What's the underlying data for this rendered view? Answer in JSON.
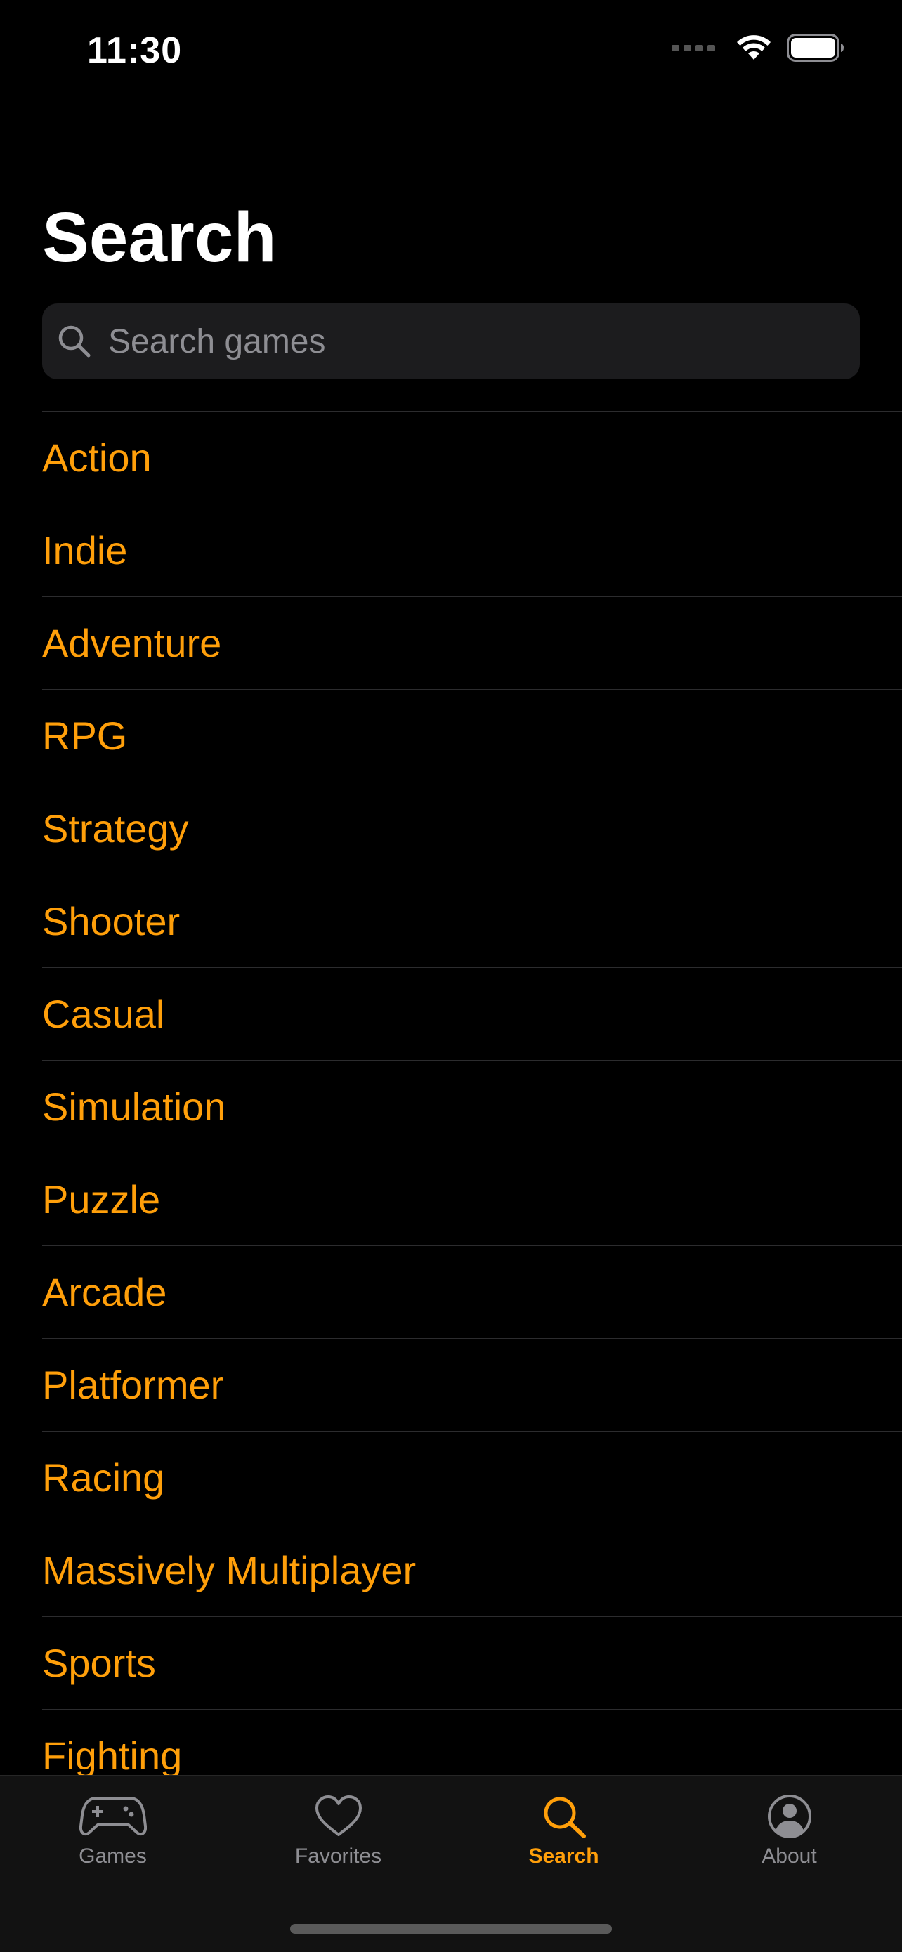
{
  "status_bar": {
    "time": "11:30"
  },
  "header": {
    "title": "Search"
  },
  "search": {
    "placeholder": "Search games",
    "value": ""
  },
  "genres": [
    "Action",
    "Indie",
    "Adventure",
    "RPG",
    "Strategy",
    "Shooter",
    "Casual",
    "Simulation",
    "Puzzle",
    "Arcade",
    "Platformer",
    "Racing",
    "Massively Multiplayer",
    "Sports",
    "Fighting"
  ],
  "tab_bar": {
    "tabs": [
      {
        "label": "Games",
        "icon": "gamepad-icon",
        "active": false
      },
      {
        "label": "Favorites",
        "icon": "heart-icon",
        "active": false
      },
      {
        "label": "Search",
        "icon": "magnifier-icon",
        "active": true
      },
      {
        "label": "About",
        "icon": "person-circle-icon",
        "active": false
      }
    ]
  },
  "colors": {
    "accent": "#ff9f0a",
    "background": "#000000",
    "inactive_tab": "#8e8e93"
  }
}
